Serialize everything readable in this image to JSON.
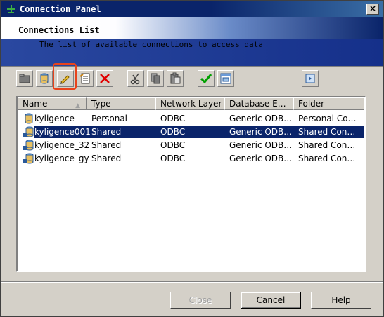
{
  "window": {
    "title": "Connection Panel",
    "close_glyph": "×"
  },
  "header": {
    "title": "Connections List",
    "subtitle": "The list of available connections to access data"
  },
  "toolbar": {
    "buttons": [
      {
        "name": "new-folder-button",
        "icon": "folder-icon"
      },
      {
        "name": "new-connection-button",
        "icon": "database-icon"
      },
      {
        "name": "edit-connection-button",
        "icon": "pencil-icon"
      },
      {
        "name": "properties-button",
        "icon": "properties-icon"
      },
      {
        "name": "delete-button",
        "icon": "delete-icon",
        "color": "#e00000"
      },
      {
        "name": "cut-button",
        "icon": "scissors-icon"
      },
      {
        "name": "copy-button",
        "icon": "copy-icon"
      },
      {
        "name": "paste-button",
        "icon": "paste-icon"
      },
      {
        "name": "test-connection-button",
        "icon": "checkmark-icon",
        "color": "#00a000"
      },
      {
        "name": "connection-info-button",
        "icon": "window-icon"
      },
      {
        "name": "select-button",
        "icon": "select-icon"
      }
    ]
  },
  "list": {
    "columns": [
      "Name",
      "Type",
      "Network Layer",
      "Database E…",
      "Folder"
    ],
    "sort_glyph": "▲",
    "rows": [
      {
        "name": "kyligence",
        "type": "Personal",
        "network": "ODBC",
        "database": "Generic ODB…",
        "folder": "Personal Co…",
        "shared": false
      },
      {
        "name": "kyligence001",
        "type": "Shared",
        "network": "ODBC",
        "database": "Generic ODB…",
        "folder": "Shared Con…",
        "shared": true,
        "selected": true
      },
      {
        "name": "kyligence_32",
        "type": "Shared",
        "network": "ODBC",
        "database": "Generic ODB…",
        "folder": "Shared Con…",
        "shared": true
      },
      {
        "name": "kyligence_gy",
        "type": "Shared",
        "network": "ODBC",
        "database": "Generic ODB…",
        "folder": "Shared Con…",
        "shared": true
      }
    ]
  },
  "buttons": {
    "close": "Close",
    "cancel": "Cancel",
    "help": "Help"
  },
  "colors": {
    "selection": "#0a246a",
    "highlight": "#e8431c",
    "face": "#d4d0c8"
  }
}
